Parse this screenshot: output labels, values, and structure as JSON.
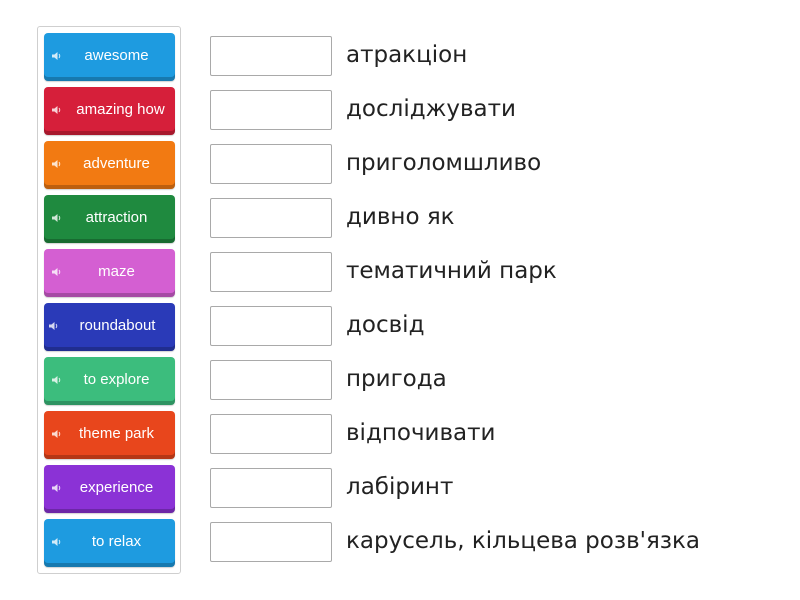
{
  "cards": [
    {
      "label": "awesome",
      "color": "#1e9be0",
      "icon": "speaker-icon"
    },
    {
      "label": "amazing how",
      "color": "#d61f3a",
      "icon": "speaker-icon"
    },
    {
      "label": "adventure",
      "color": "#f27a12",
      "icon": "speaker-icon"
    },
    {
      "label": "attraction",
      "color": "#1f8a3f",
      "icon": "speaker-icon"
    },
    {
      "label": "maze",
      "color": "#d45fd2",
      "icon": "speaker-icon"
    },
    {
      "label": "roundabout",
      "color": "#2a3ab8",
      "icon": "speaker-icon"
    },
    {
      "label": "to explore",
      "color": "#3cbd7d",
      "icon": "speaker-icon"
    },
    {
      "label": "theme park",
      "color": "#e8461c",
      "icon": "speaker-icon"
    },
    {
      "label": "experience",
      "color": "#8b32d6",
      "icon": "speaker-icon"
    },
    {
      "label": "to relax",
      "color": "#1e9be0",
      "icon": "speaker-icon"
    }
  ],
  "targets": [
    {
      "text": "атракціон",
      "slot_value": ""
    },
    {
      "text": "досліджувати",
      "slot_value": ""
    },
    {
      "text": "приголомшливо",
      "slot_value": ""
    },
    {
      "text": "дивно як",
      "slot_value": ""
    },
    {
      "text": "тематичний парк",
      "slot_value": ""
    },
    {
      "text": "досвід",
      "slot_value": ""
    },
    {
      "text": "пригода",
      "slot_value": ""
    },
    {
      "text": "відпочивати",
      "slot_value": ""
    },
    {
      "text": "лабіринт",
      "slot_value": ""
    },
    {
      "text": "карусель, кільцева розв'язка",
      "slot_value": ""
    }
  ]
}
